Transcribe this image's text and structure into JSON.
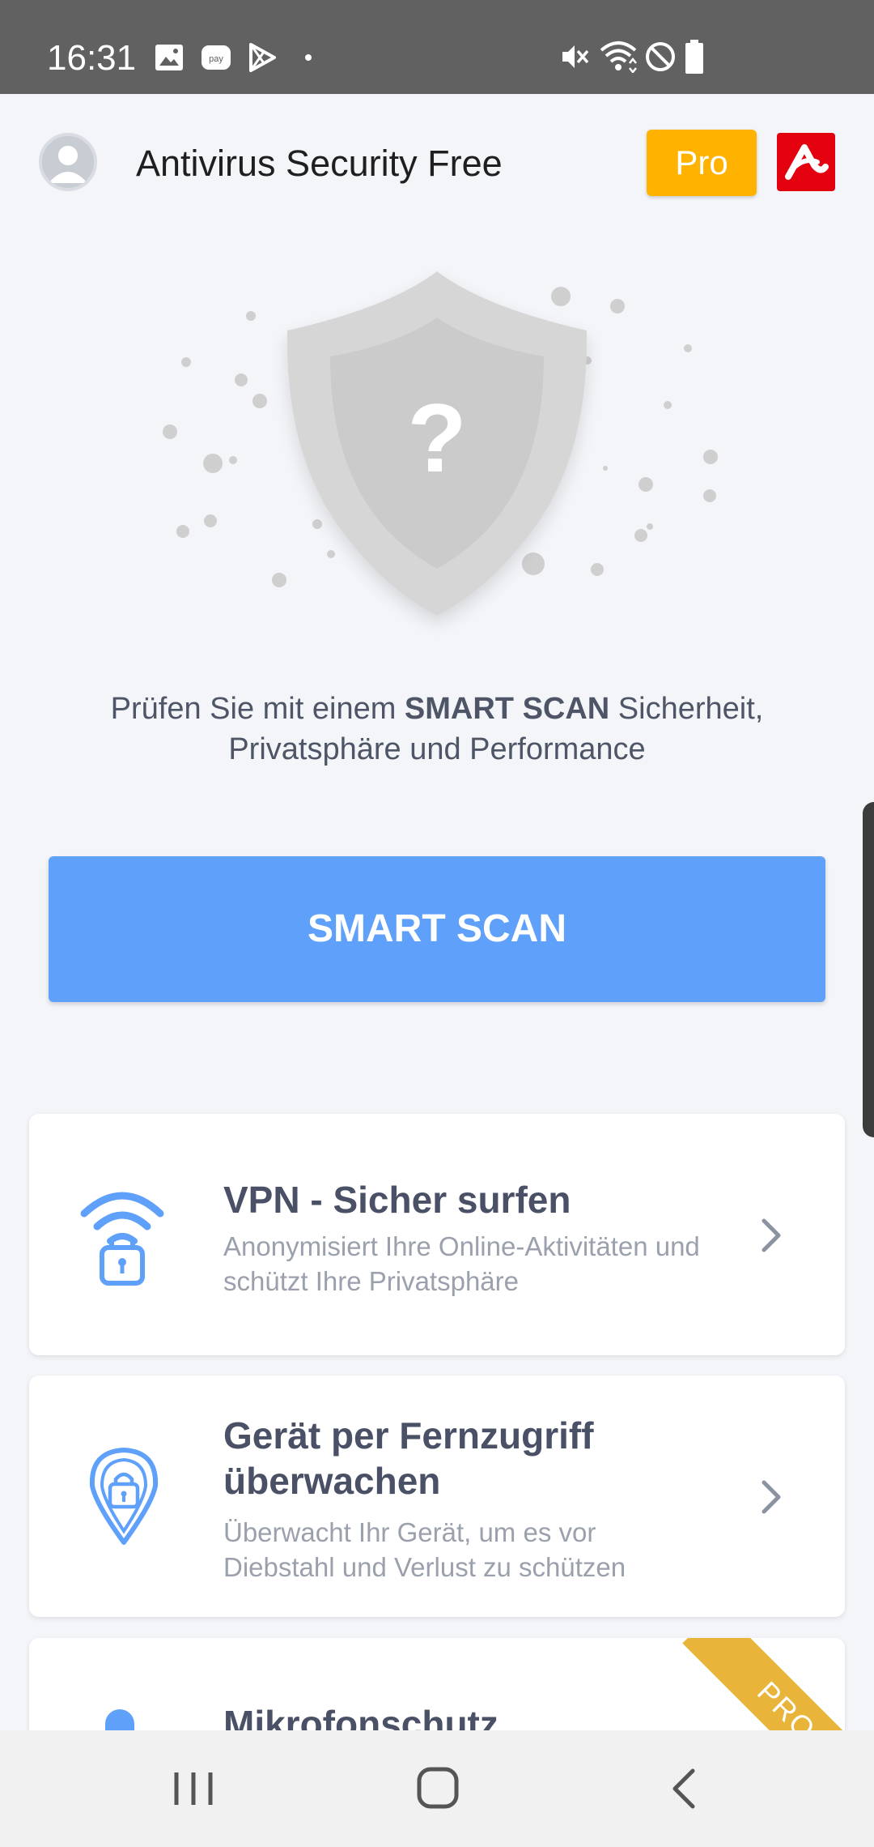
{
  "status_bar": {
    "time": "16:31",
    "left_icons": [
      "image-icon",
      "pay-icon",
      "play-store-icon",
      "dot-icon"
    ],
    "right_icons": [
      "mute-icon",
      "wifi-icon",
      "do-not-disturb-icon",
      "battery-icon"
    ]
  },
  "header": {
    "title": "Antivirus Security Free",
    "pro_label": "Pro",
    "pro_color": "#ffb300",
    "brand_color": "#e3000f"
  },
  "hero": {
    "symbol": "?",
    "text_pre": "Prüfen Sie mit einem ",
    "text_bold": "SMART SCAN",
    "text_post": " Sicherheit, Privatsphäre und Performance"
  },
  "scan_button": {
    "label": "SMART SCAN",
    "color": "#5fa0fa"
  },
  "cards": [
    {
      "icon": "wifi-lock-icon",
      "title": "VPN - Sicher surfen",
      "description": "Anonymisiert Ihre Online-Aktivitäten und schützt Ihre Privatsphäre"
    },
    {
      "icon": "location-lock-icon",
      "title": "Gerät per Fernzugriff überwachen",
      "description": "Überwacht Ihr Gerät, um es vor Diebstahl und Verlust zu schützen"
    },
    {
      "icon": "microphone-icon",
      "title": "Mikrofonschutz",
      "badge": "PRO"
    }
  ],
  "accent_color": "#5fa0fa",
  "nav_bar": [
    "recent-apps-icon",
    "home-icon",
    "back-icon"
  ]
}
